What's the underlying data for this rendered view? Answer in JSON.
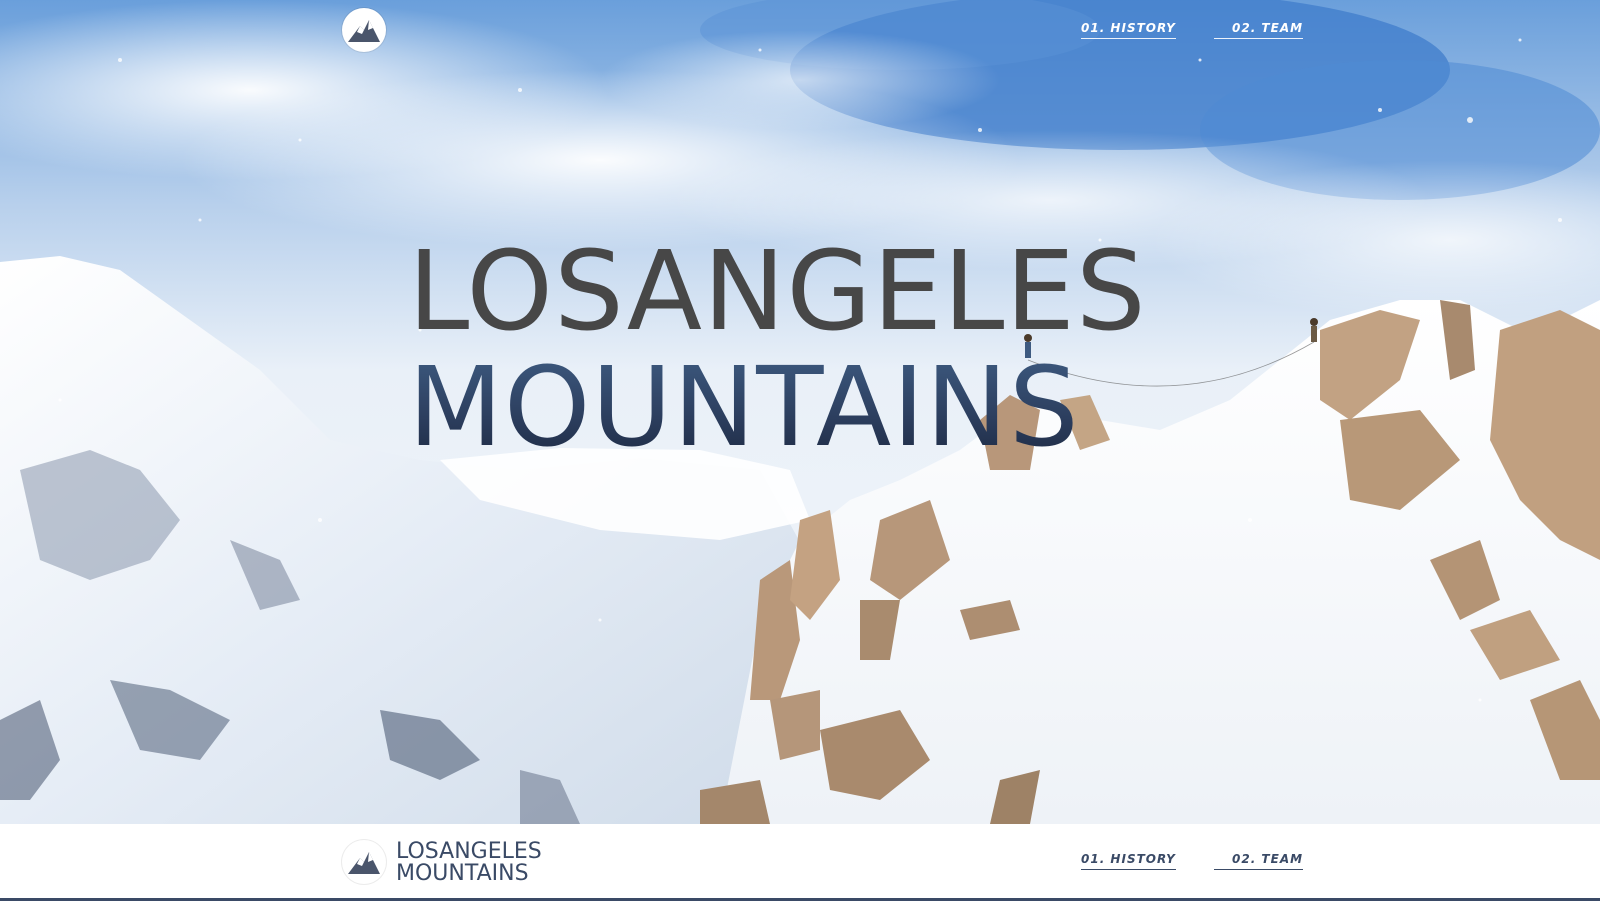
{
  "brand": {
    "line1": "LOSANGELES",
    "line2": "MOUNTAINS",
    "logo_icon": "mountain-peak-icon"
  },
  "nav": {
    "items": [
      {
        "label": "01. HISTORY"
      },
      {
        "label": "02. TEAM"
      }
    ]
  },
  "hero": {
    "title_line1": "LOSANGELES",
    "title_line2": "MOUNTAINS"
  },
  "footer": {
    "brand_line1": "LOSANGELES",
    "brand_line2": "MOUNTAINS",
    "nav": [
      {
        "label": "01. HISTORY"
      },
      {
        "label": "02. TEAM"
      }
    ]
  },
  "colors": {
    "headline_dark": "#474747",
    "headline_navy": "#2c3e5e",
    "footer_accent": "#3a4a66",
    "sky_blue": "#4a86cf"
  }
}
